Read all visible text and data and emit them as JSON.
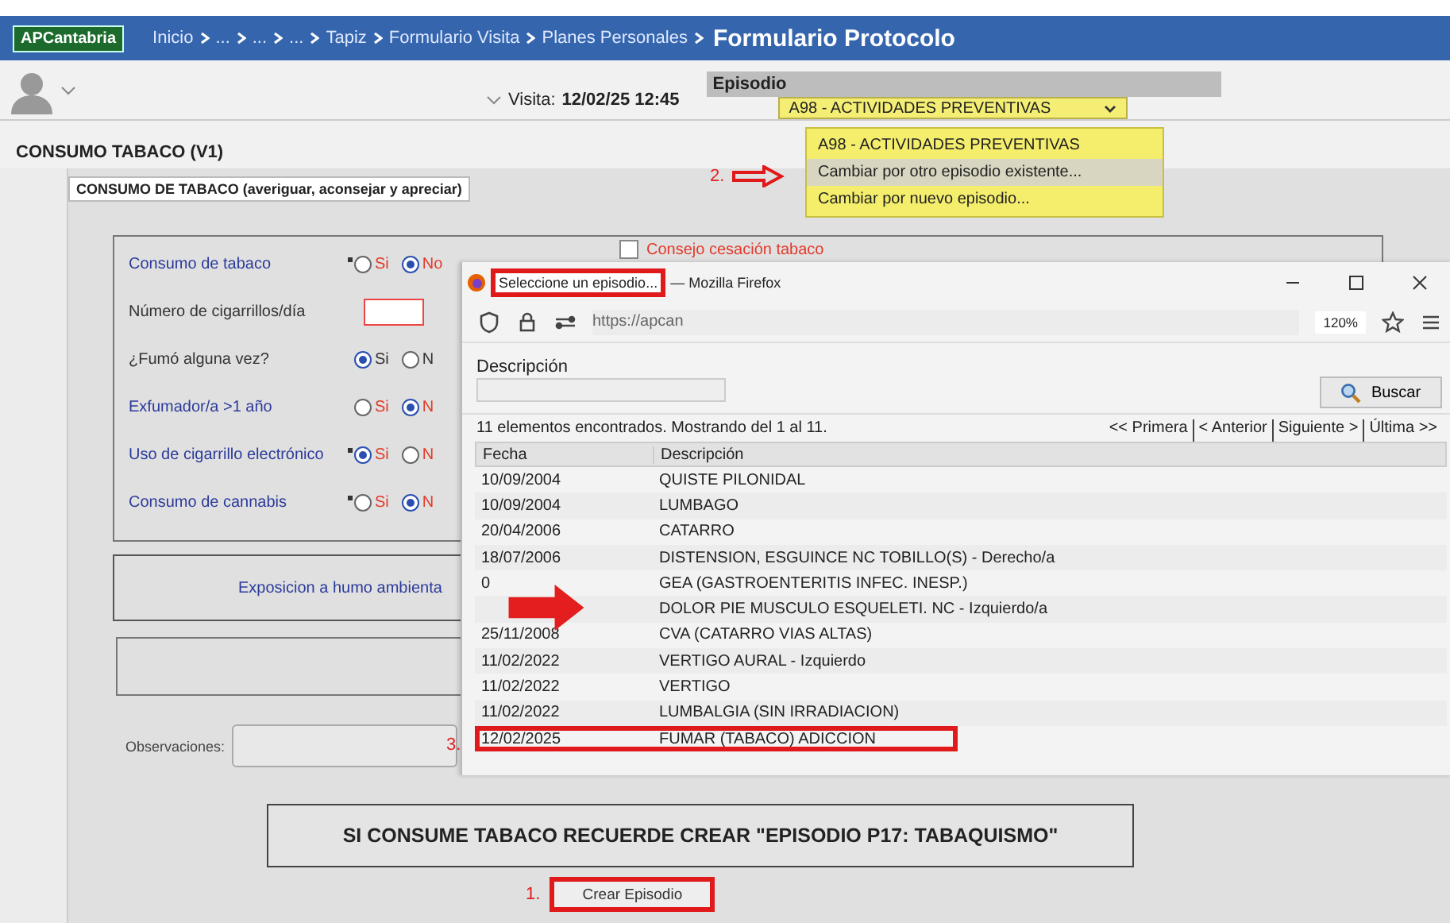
{
  "header": {
    "logo": "APCantabria",
    "breadcrumb": [
      "Inicio",
      "...",
      "...",
      "...",
      "Tapiz",
      "Formulario Visita",
      "Planes Personales"
    ],
    "current": "Formulario Protocolo"
  },
  "visit": {
    "label": "Visita:",
    "value": "12/02/25 12:45"
  },
  "episode": {
    "label": "Episodio",
    "value": "A98 - ACTIVIDADES PREVENTIVAS",
    "expanded": true,
    "options": [
      {
        "label": "A98 - ACTIVIDADES PREVENTIVAS",
        "highlighted": false
      },
      {
        "label": "Cambiar por otro episodio existente...",
        "highlighted": true
      },
      {
        "label": "Cambiar por nuevo episodio...",
        "highlighted": false
      }
    ]
  },
  "section_title": "CONSUMO TABACO (V1)",
  "tab": {
    "label": "CONSUMO DE TABACO (averiguar, aconsejar y apreciar)",
    "selected": true
  },
  "form_rows": [
    {
      "kind": "radio",
      "label": "Consumo de tabaco",
      "required": true,
      "emphasis": true,
      "options": [
        {
          "label": "Si",
          "selected": false
        },
        {
          "label": "No",
          "selected": true
        }
      ]
    },
    {
      "kind": "number",
      "label": "Número de cigarrillos/día"
    },
    {
      "kind": "radio",
      "label": "¿Fumó alguna vez?",
      "required": false,
      "emphasis": false,
      "options": [
        {
          "label": "Si",
          "selected": true
        },
        {
          "label": "N",
          "selected": false
        }
      ]
    },
    {
      "kind": "radio",
      "label": "Exfumador/a >1 año",
      "required": false,
      "emphasis": true,
      "options": [
        {
          "label": "Si",
          "selected": false
        },
        {
          "label": "N",
          "selected": true
        }
      ]
    },
    {
      "kind": "radio",
      "label": "Uso de cigarrillo electrónico",
      "required": true,
      "emphasis": true,
      "options": [
        {
          "label": "Si",
          "selected": true
        },
        {
          "label": "N",
          "selected": false
        }
      ]
    },
    {
      "kind": "radio",
      "label": "Consumo de cannabis",
      "required": true,
      "emphasis": true,
      "options": [
        {
          "label": "Si",
          "selected": false
        },
        {
          "label": "N",
          "selected": true
        }
      ]
    }
  ],
  "advice_checkbox": {
    "label": "Consejo cesación tabaco",
    "checked": false
  },
  "exposure_label": "Exposicion a humo ambienta",
  "observations_label": "Observaciones:",
  "banner": "SI CONSUME TABACO RECUERDE CREAR \"EPISODIO P17: TABAQUISMO\"",
  "create_button": "Crear Episodio",
  "steps": [
    "1.",
    "2.",
    "3."
  ],
  "popup": {
    "title": "Seleccione un episodio...",
    "app": "— Mozilla Firefox",
    "url": "https://apcan",
    "zoom": "120%",
    "search_label": "Descripción",
    "search_button": "Buscar",
    "result_count": "11 elementos encontrados. Mostrando del 1 al 11.",
    "pagination": [
      "<< Primera",
      "< Anterior",
      "Siguiente >",
      "Última >>"
    ],
    "columns": [
      "Fecha",
      "Descripción"
    ],
    "rows": [
      {
        "date": "10/09/2004",
        "description": "QUISTE PILONIDAL",
        "selected": false
      },
      {
        "date": "10/09/2004",
        "description": "LUMBAGO",
        "selected": false
      },
      {
        "date": "20/04/2006",
        "description": "CATARRO",
        "selected": false
      },
      {
        "date": "18/07/2006",
        "description": "DISTENSION, ESGUINCE NC TOBILLO(S) - Derecho/a",
        "selected": false
      },
      {
        "date": "0",
        "description": "GEA (GASTROENTERITIS INFEC. INESP.)",
        "selected": false
      },
      {
        "description": "DOLOR PIE MUSCULO ESQUELETI. NC - Izquierdo/a",
        "selected": false
      },
      {
        "date": "25/11/2008",
        "description": "CVA (CATARRO VIAS ALTAS)",
        "selected": false
      },
      {
        "date": "11/02/2022",
        "description": "VERTIGO AURAL - Izquierdo",
        "selected": false
      },
      {
        "date": "11/02/2022",
        "description": "VERTIGO",
        "selected": false
      },
      {
        "date": "11/02/2022",
        "description": "LUMBALGIA (SIN IRRADIACION)",
        "selected": false
      },
      {
        "date": "12/02/2025",
        "description": "FUMAR (TABACO) ADICCION",
        "selected": true
      }
    ]
  }
}
